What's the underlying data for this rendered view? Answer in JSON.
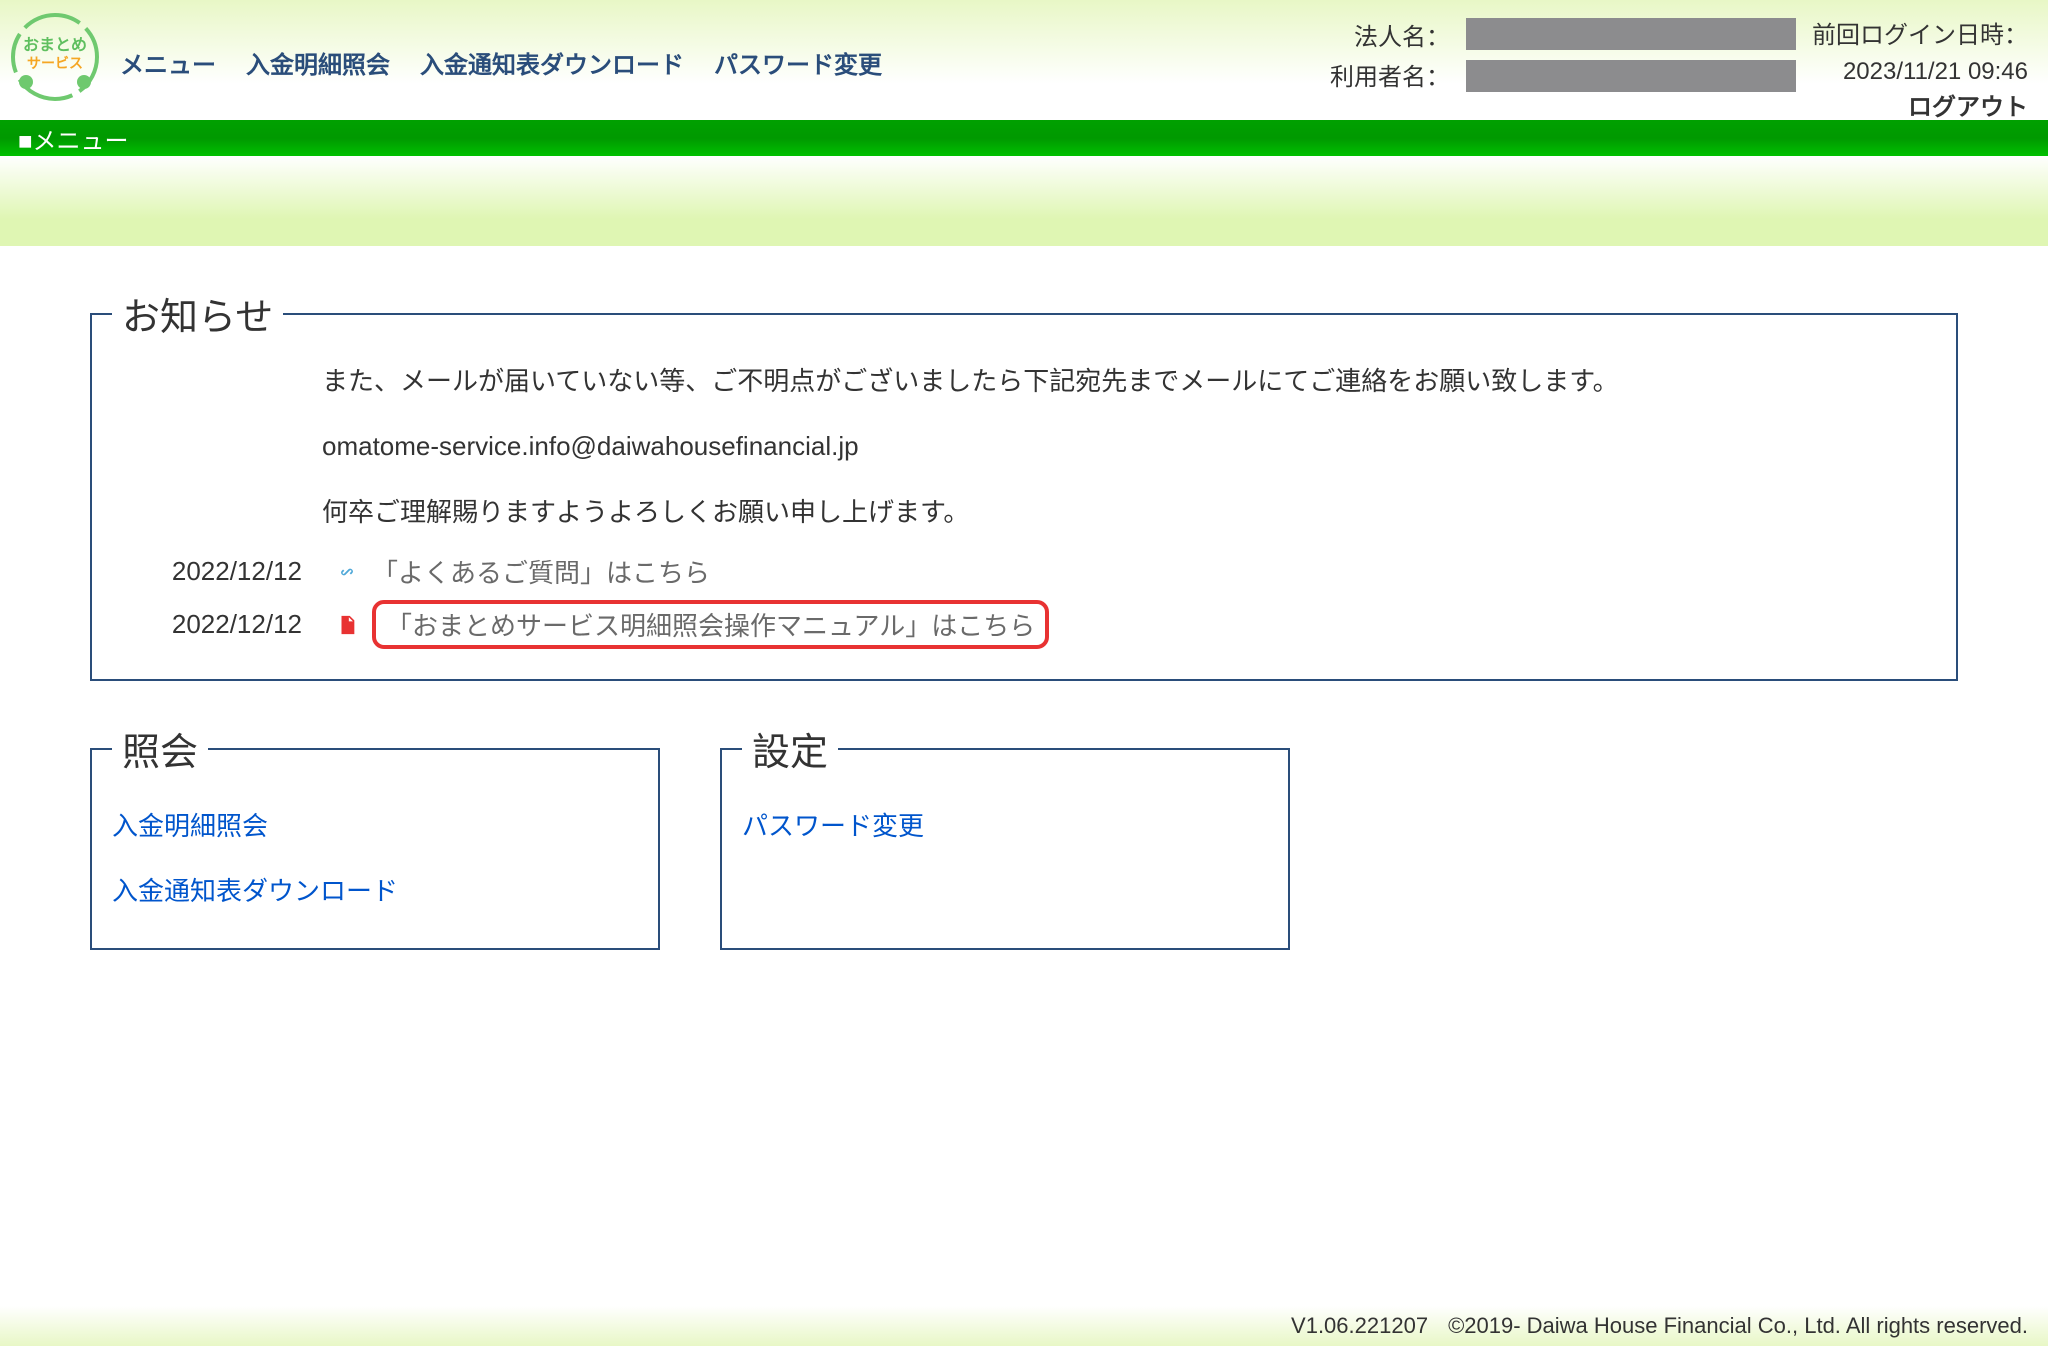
{
  "logo": {
    "top_text": "おまとめ",
    "bottom_text": "サービス"
  },
  "nav": {
    "menu": "メニュー",
    "deposit_detail": "入金明細照会",
    "deposit_notice_dl": "入金通知表ダウンロード",
    "password_change": "パスワード変更"
  },
  "user": {
    "company_label": "法人名：",
    "user_label": "利用者名："
  },
  "login_meta": {
    "last_login_label": "前回ログイン日時：",
    "last_login_value": "2023/11/21 09:46",
    "logout": "ログアウト"
  },
  "green_bar_title": "■メニュー",
  "notice": {
    "legend": "お知らせ",
    "line1": "また、メールが届いていない等、ご不明点がございましたら下記宛先までメールにてご連絡をお願い致します。",
    "line2": "omatome-service.info@daiwahousefinancial.jp",
    "line3": "何卒ご理解賜りますようよろしくお願い申し上げます。",
    "rows": [
      {
        "date": "2022/12/12",
        "icon": "link",
        "text": "「よくあるご質問」はこちら"
      },
      {
        "date": "2022/12/12",
        "icon": "pdf",
        "text": "「おまとめサービス明細照会操作マニュアル」はこちら",
        "highlight": true
      }
    ]
  },
  "inquiry": {
    "legend": "照会",
    "links": [
      "入金明細照会",
      "入金通知表ダウンロード"
    ]
  },
  "settings": {
    "legend": "設定",
    "links": [
      "パスワード変更"
    ]
  },
  "footer": {
    "version": "V1.06.221207",
    "copyright": "©2019- Daiwa House Financial Co., Ltd. All rights reserved."
  }
}
